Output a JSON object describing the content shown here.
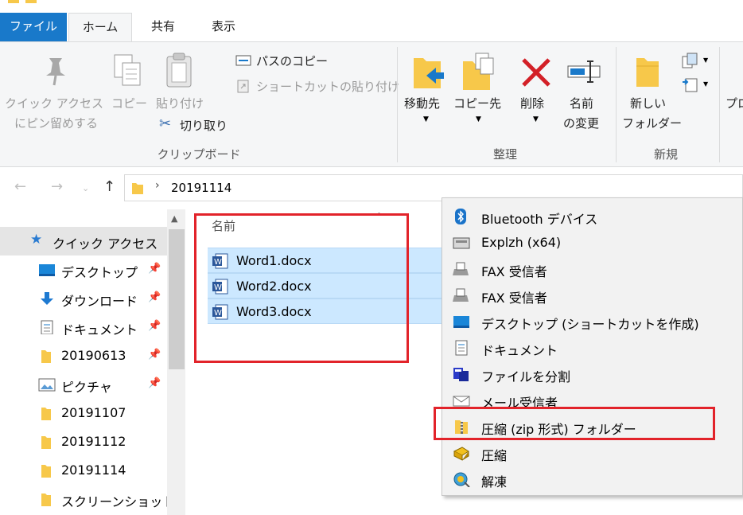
{
  "ribbon": {
    "tabs": {
      "file": "ファイル",
      "home": "ホーム",
      "share": "共有",
      "view": "表示"
    },
    "clipboard": {
      "pin_line1": "クイック アクセス",
      "pin_line2": "にピン留めする",
      "copy": "コピー",
      "paste": "貼り付け",
      "copy_path": "パスのコピー",
      "paste_shortcut": "ショートカットの貼り付け",
      "cut": "切り取り",
      "group": "クリップボード"
    },
    "organize": {
      "move_to": "移動先",
      "copy_to": "コピー先",
      "delete": "削除",
      "rename_line1": "名前",
      "rename_line2": "の変更",
      "group": "整理"
    },
    "new": {
      "new_folder_line1": "新しい",
      "new_folder_line2": "フォルダー",
      "group": "新規"
    },
    "properties_partial": "プロ"
  },
  "address": {
    "path": "20191114"
  },
  "nav": {
    "items": [
      {
        "label": "クイック アクセス",
        "icon": "star-icon"
      },
      {
        "label": "デスクトップ",
        "icon": "desktop-icon",
        "pinned": true
      },
      {
        "label": "ダウンロード",
        "icon": "download-icon",
        "pinned": true
      },
      {
        "label": "ドキュメント",
        "icon": "document-icon",
        "pinned": true
      },
      {
        "label": "20190613",
        "icon": "folder-icon",
        "pinned": true
      },
      {
        "label": "ピクチャ",
        "icon": "picture-icon",
        "pinned": true
      },
      {
        "label": "20191107",
        "icon": "folder-icon"
      },
      {
        "label": "20191112",
        "icon": "folder-icon"
      },
      {
        "label": "20191114",
        "icon": "folder-icon"
      },
      {
        "label": "スクリーンショット",
        "icon": "folder-icon"
      }
    ]
  },
  "files": {
    "column_name": "名前",
    "rows": [
      {
        "name": "Word1.docx"
      },
      {
        "name": "Word2.docx"
      },
      {
        "name": "Word3.docx"
      }
    ]
  },
  "context_menu": {
    "items": [
      {
        "label": "Bluetooth デバイス",
        "icon": "bluetooth-icon"
      },
      {
        "label": "Explzh (x64)",
        "icon": "explzh-icon"
      },
      {
        "label": "FAX 受信者",
        "icon": "fax-icon"
      },
      {
        "label": "FAX 受信者",
        "icon": "fax-icon"
      },
      {
        "label": "デスクトップ (ショートカットを作成)",
        "icon": "desktop-icon"
      },
      {
        "label": "ドキュメント",
        "icon": "document-icon"
      },
      {
        "label": "ファイルを分割",
        "icon": "split-file-icon"
      },
      {
        "label": "メール受信者",
        "icon": "mail-icon"
      },
      {
        "label": "圧縮 (zip 形式) フォルダー",
        "icon": "zip-folder-icon"
      },
      {
        "label": "圧縮",
        "icon": "compress-icon"
      },
      {
        "label": "解凍",
        "icon": "extract-icon"
      }
    ]
  },
  "colors": {
    "accent": "#1979ca",
    "selection": "#cce8ff",
    "highlight_box": "#e2232a",
    "folder": "#f7c84a"
  }
}
